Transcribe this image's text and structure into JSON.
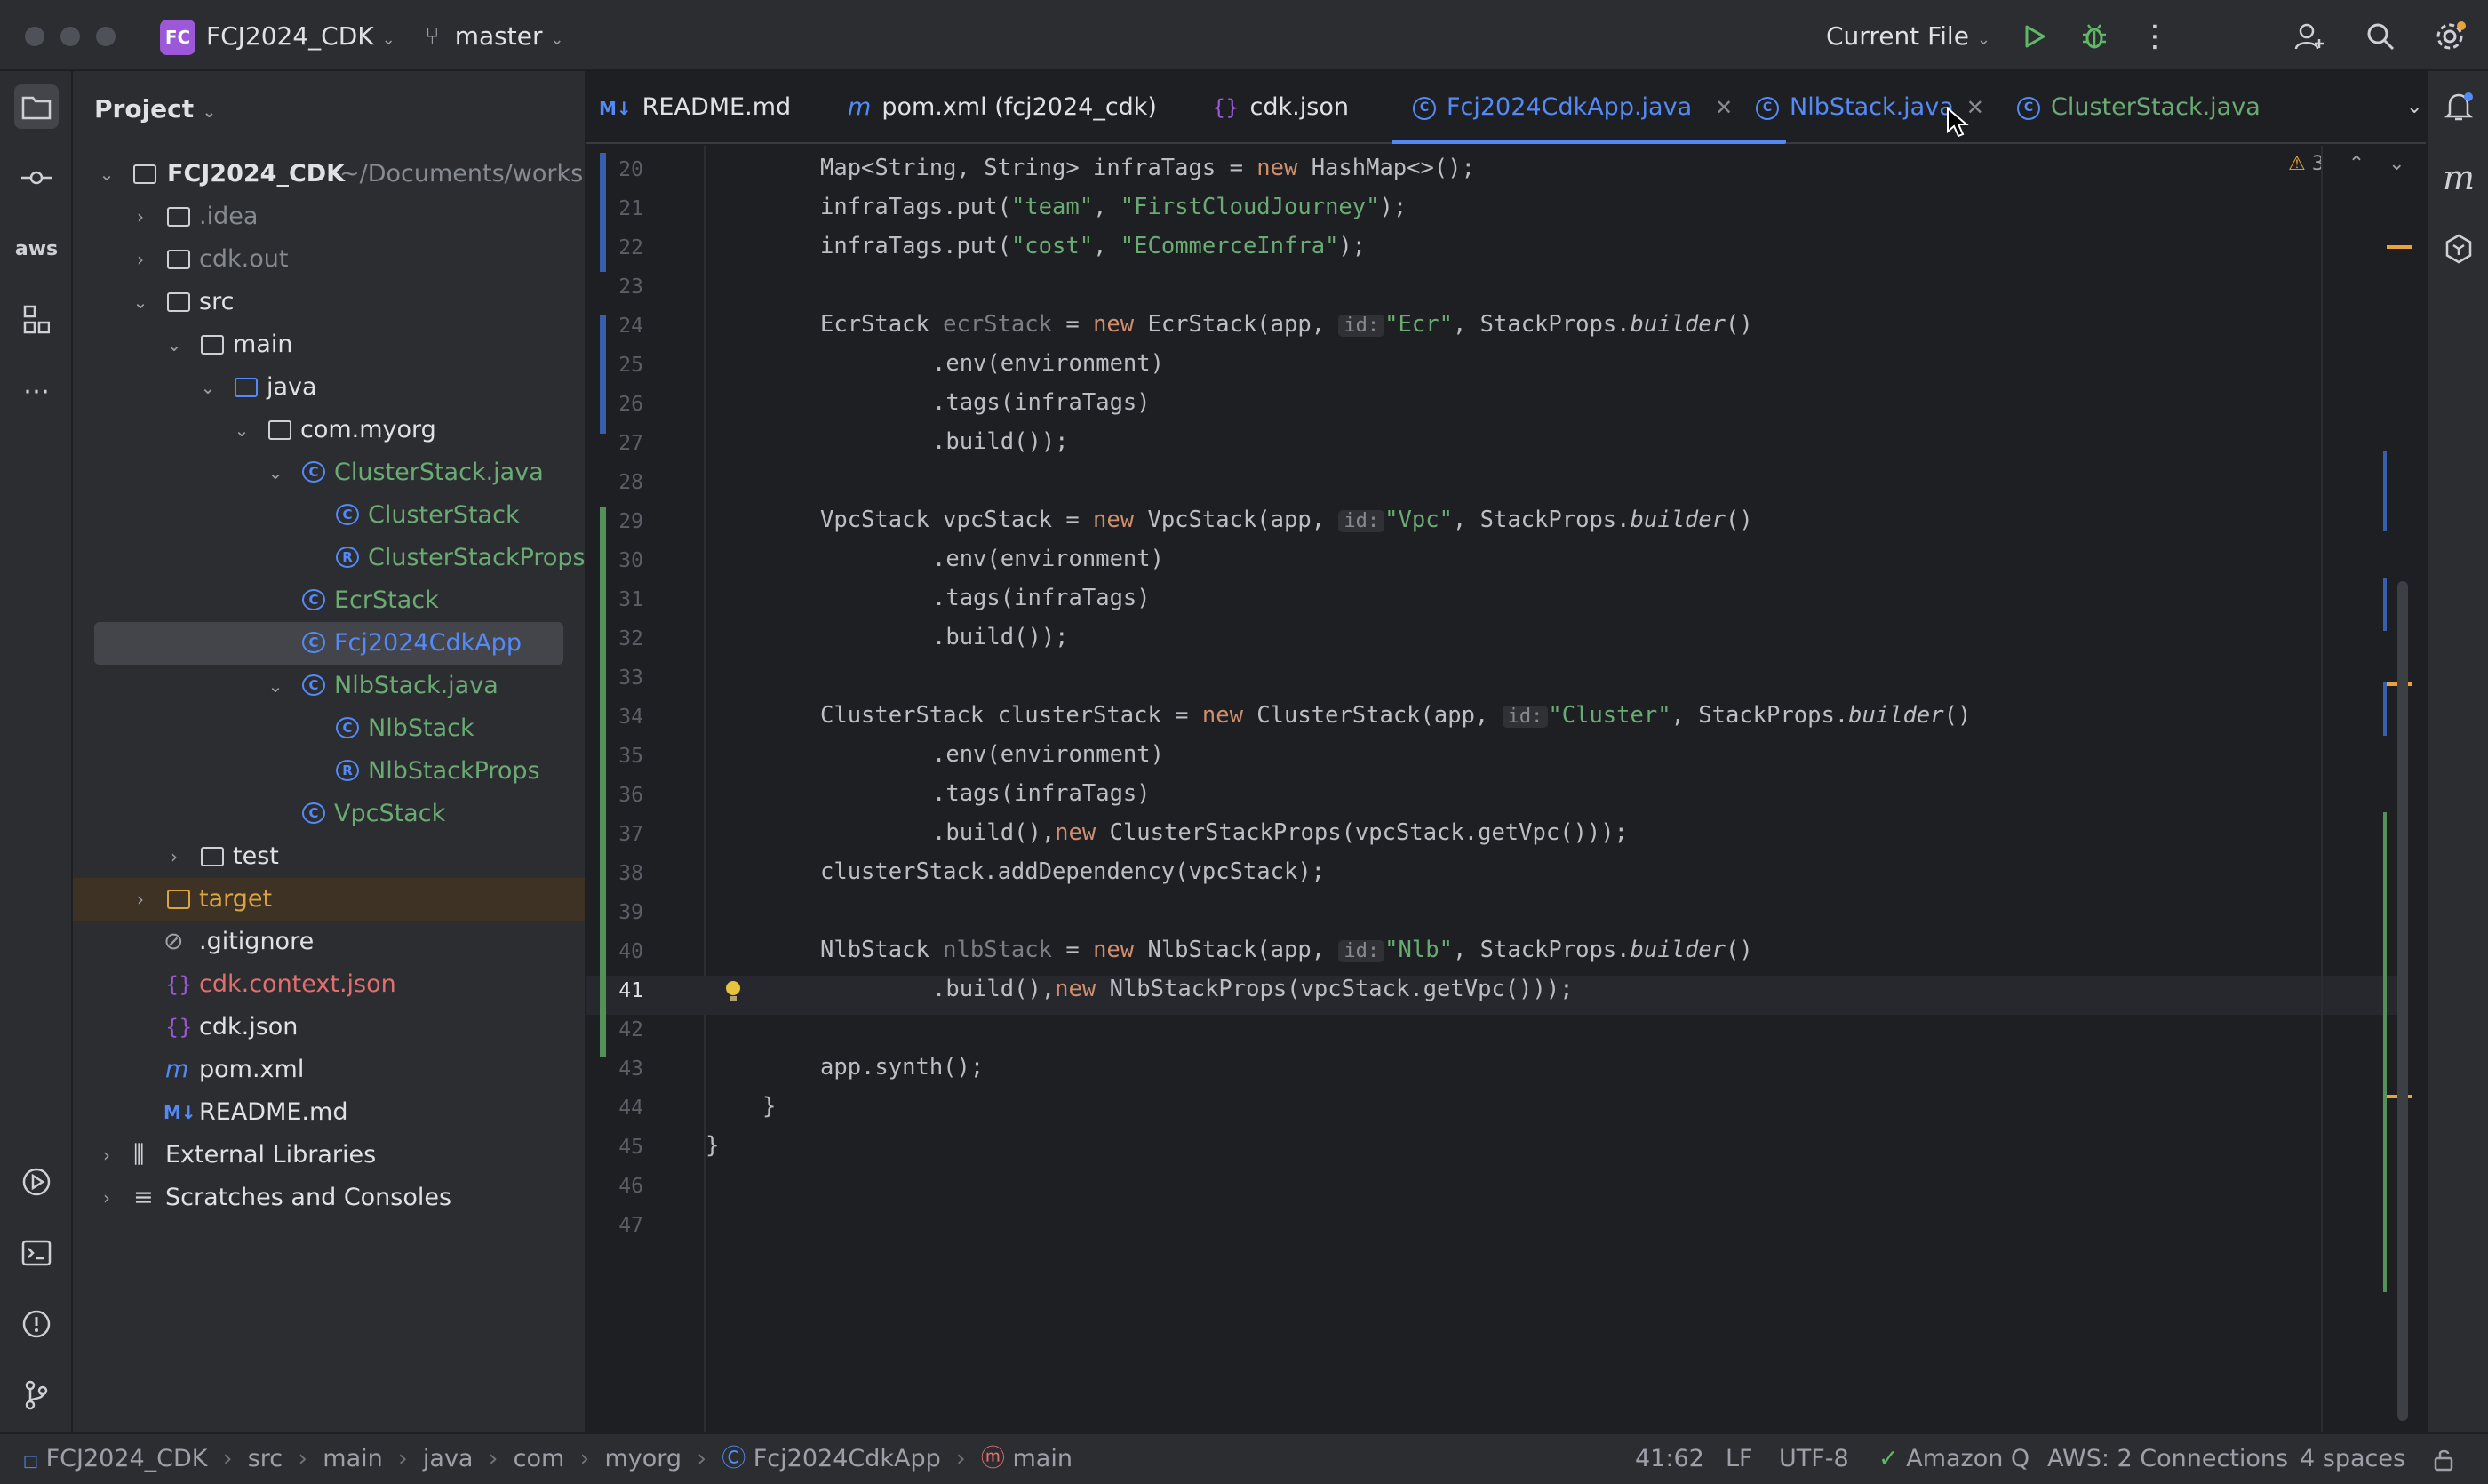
{
  "titlebar": {
    "project_badge": "FC",
    "project_name": "FCJ2024_CDK",
    "branch": "master",
    "run_config": "Current File"
  },
  "project_panel": {
    "title": "Project",
    "root_name": "FCJ2024_CDK",
    "root_path": "~/Documents/workshop",
    "items": [
      {
        "label": ".idea"
      },
      {
        "label": "cdk.out"
      },
      {
        "label": "src"
      },
      {
        "label": "main"
      },
      {
        "label": "java"
      },
      {
        "label": "com.myorg"
      },
      {
        "label": "ClusterStack.java"
      },
      {
        "label": "ClusterStack"
      },
      {
        "label": "ClusterStackProps"
      },
      {
        "label": "EcrStack"
      },
      {
        "label": "Fcj2024CdkApp"
      },
      {
        "label": "NlbStack.java"
      },
      {
        "label": "NlbStack"
      },
      {
        "label": "NlbStackProps"
      },
      {
        "label": "VpcStack"
      },
      {
        "label": "test"
      },
      {
        "label": "target"
      },
      {
        "label": ".gitignore"
      },
      {
        "label": "cdk.context.json"
      },
      {
        "label": "cdk.json"
      },
      {
        "label": "pom.xml"
      },
      {
        "label": "README.md"
      },
      {
        "label": "External Libraries"
      },
      {
        "label": "Scratches and Consoles"
      }
    ]
  },
  "tabs": [
    {
      "icon": "M↓",
      "label": "README.md"
    },
    {
      "icon": "m",
      "label": "pom.xml (fcj2024_cdk)"
    },
    {
      "icon": "{}",
      "label": "cdk.json"
    },
    {
      "icon": "C",
      "label": "Fcj2024CdkApp.java"
    },
    {
      "icon": "C",
      "label": "NlbStack.java"
    },
    {
      "icon": "C",
      "label": "ClusterStack.java"
    }
  ],
  "editor": {
    "warnings_count": "3",
    "line_numbers": [
      "20",
      "21",
      "22",
      "23",
      "24",
      "25",
      "26",
      "27",
      "28",
      "29",
      "30",
      "31",
      "32",
      "33",
      "34",
      "35",
      "36",
      "37",
      "38",
      "39",
      "40",
      "41",
      "42",
      "43",
      "44",
      "45",
      "46",
      "47"
    ],
    "code": {
      "l20a": "Map<String, String> infraTags = ",
      "l20b": "new",
      "l20c": " HashMap<>();",
      "l21a": "infraTags.put(",
      "l21b": "\"team\"",
      "l21c": ", ",
      "l21d": "\"FirstCloudJourney\"",
      "l21e": ");",
      "l22a": "infraTags.put(",
      "l22b": "\"cost\"",
      "l22c": ", ",
      "l22d": "\"ECommerceInfra\"",
      "l22e": ");",
      "l24a": "EcrStack ",
      "l24b": "ecrStack",
      "l24c": " = ",
      "l24d": "new",
      "l24e": " EcrStack(app, ",
      "l24f": "id:",
      "l24g": "\"Ecr\"",
      "l24h": ", StackProps.",
      "l24i": "builder",
      "l24j": "()",
      "env": ".env(environment)",
      "tags": ".tags(infraTags)",
      "build": ".build());",
      "l29a": "VpcStack vpcStack = ",
      "l29b": "new",
      "l29c": " VpcStack(app, ",
      "l29d": "id:",
      "l29e": "\"Vpc\"",
      "l29f": ", StackProps.",
      "l29g": "builder",
      "l29h": "()",
      "l34a": "ClusterStack clusterStack = ",
      "l34b": "new",
      "l34c": " ClusterStack(app, ",
      "l34d": "id:",
      "l34e": "\"Cluster\"",
      "l34f": ", StackProps.",
      "l34g": "builder",
      "l34h": "()",
      "l37a": ".build(),",
      "l37b": "new",
      "l37c": " ClusterStackProps(vpcStack.getVpc()));",
      "l38": "clusterStack.addDependency(vpcStack);",
      "l40a": "NlbStack ",
      "l40b": "nlbStack",
      "l40c": " = ",
      "l40d": "new",
      "l40e": " NlbStack(app, ",
      "l40f": "id:",
      "l40g": "\"Nlb\"",
      "l40h": ", StackProps.",
      "l40i": "builder",
      "l40j": "()",
      "l41a": ".build(),",
      "l41b": "new",
      "l41c": " NlbStackProps(vpcStack.getVpc()));",
      "l43": "app.synth();",
      "l44": "}",
      "l45": "}"
    }
  },
  "statusbar": {
    "breadcrumbs": [
      "FCJ2024_CDK",
      "src",
      "main",
      "java",
      "com",
      "myorg",
      "Fcj2024CdkApp",
      "main"
    ],
    "position": "41:62",
    "line_ending": "LF",
    "encoding": "UTF-8",
    "amazon_q": "Amazon Q",
    "aws": "AWS: 2 Connections",
    "indent": "4 spaces"
  },
  "colors": {
    "accent": "#548af7",
    "keyword": "#cf8e6d",
    "string": "#6aab73",
    "run": "#5fb865",
    "warning": "#e8a33d"
  }
}
